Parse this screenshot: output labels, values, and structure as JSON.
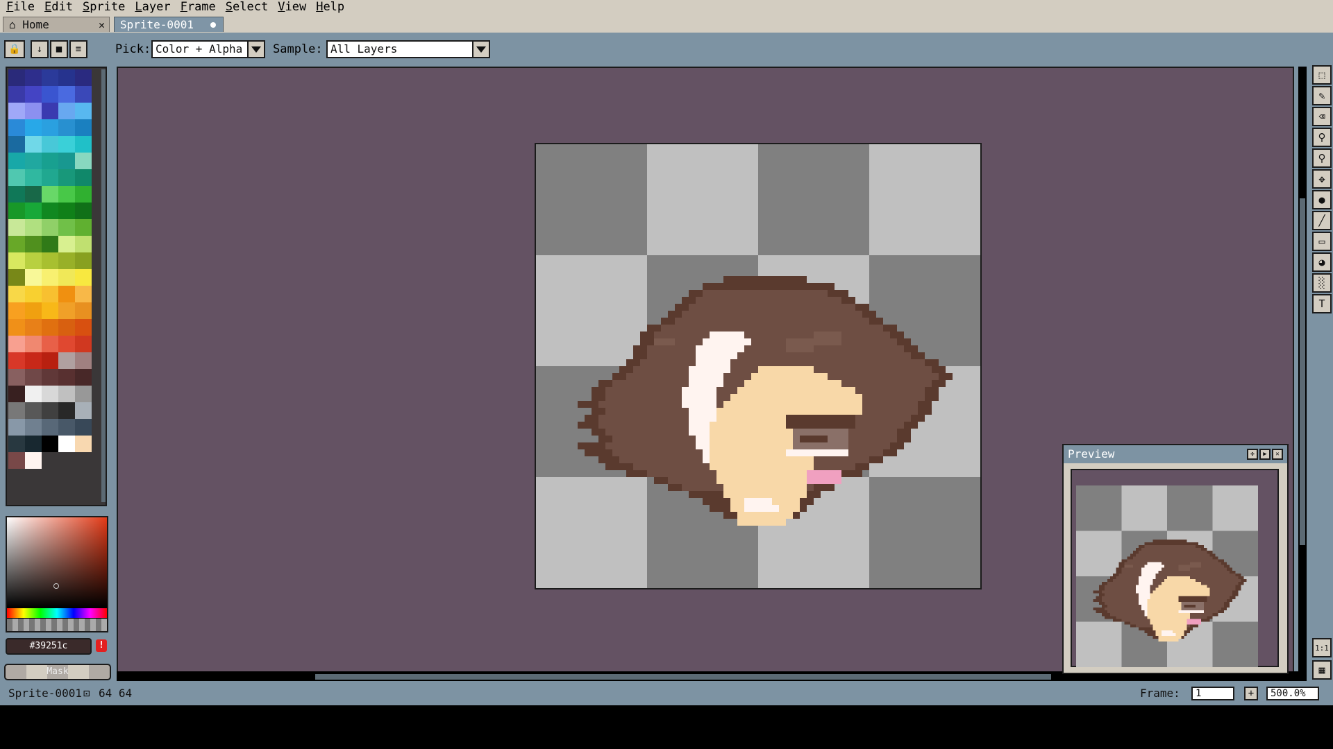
{
  "menu": [
    {
      "accel": "F",
      "rest": "ile"
    },
    {
      "accel": "E",
      "rest": "dit"
    },
    {
      "accel": "S",
      "rest": "prite"
    },
    {
      "accel": "L",
      "rest": "ayer"
    },
    {
      "accel": "F",
      "rest": "rame"
    },
    {
      "accel": "S",
      "rest": "elect"
    },
    {
      "accel": "V",
      "rest": "iew"
    },
    {
      "accel": "H",
      "rest": "elp"
    }
  ],
  "tabs": {
    "home": {
      "label": "Home",
      "close": "✕"
    },
    "sprite": {
      "label": "Sprite-0001"
    }
  },
  "context_bar": {
    "pick_label": "Pick:",
    "pick_value": "Color + Alpha",
    "sample_label": "Sample:",
    "sample_value": "All Layers"
  },
  "palette_colors": [
    "#2a2a7a",
    "#2e2e8c",
    "#2b3a9a",
    "#26338e",
    "#2a2a80",
    "#3a3aa8",
    "#4444c4",
    "#3a55d0",
    "#4a6ae0",
    "#3a48b8",
    "#a0a8f8",
    "#8c90f0",
    "#3a3ab0",
    "#68a8f0",
    "#58b8f0",
    "#2a8ad8",
    "#28a8e8",
    "#2aa0e0",
    "#2890d0",
    "#1a80c0",
    "#1a6aa0",
    "#70d8e8",
    "#48c8d8",
    "#3ad0d8",
    "#20c0c8",
    "#18a8a8",
    "#20a8a0",
    "#18a090",
    "#189890",
    "#88d8c0",
    "#50c8b0",
    "#30b8a0",
    "#20a890",
    "#18987a",
    "#10886a",
    "#107858",
    "#186848",
    "#68d868",
    "#48c848",
    "#30b030",
    "#189828",
    "#18a838",
    "#108820",
    "#108018",
    "#107018",
    "#c8e898",
    "#b0e080",
    "#90d068",
    "#70c048",
    "#60b030",
    "#68a828",
    "#50901e",
    "#307a18",
    "#d8f090",
    "#c0e070",
    "#d8e860",
    "#b8d040",
    "#a8c030",
    "#98b028",
    "#88a020",
    "#788818",
    "#f8f898",
    "#f8f070",
    "#f0e858",
    "#f8e840",
    "#f8d848",
    "#f8d030",
    "#f8c030",
    "#f09010",
    "#f8b848",
    "#f8a020",
    "#f0a010",
    "#f8b818",
    "#f0a028",
    "#e89020",
    "#f09018",
    "#e88018",
    "#e07010",
    "#d86010",
    "#d85010",
    "#f8a090",
    "#f08870",
    "#e86048",
    "#e04830",
    "#d03820",
    "#d83828",
    "#c82818",
    "#b82010",
    "#b0a0a0",
    "#a08080",
    "#886060",
    "#704848",
    "#603838",
    "#583030",
    "#482828",
    "#382020",
    "#f0f0f0",
    "#d8d8d8",
    "#c0c0c0",
    "#989898",
    "#787878",
    "#585858",
    "#404040",
    "#282828",
    "#a8b0b8",
    "#8898a8",
    "#708090",
    "#586878",
    "#485868",
    "#384858",
    "#283840",
    "#182830",
    "#000000",
    "#ffffff",
    "#f8d8b0",
    "#784848",
    "#fff4f0"
  ],
  "picker": {
    "hex": "#39251c",
    "warn": "!",
    "mask_label": "Mask"
  },
  "tools": [
    "marquee-icon",
    "pencil-icon",
    "eraser-icon",
    "eyedropper-icon",
    "zoom-icon",
    "move-icon",
    "fill-icon",
    "line-icon",
    "rectangle-icon",
    "blur-icon",
    "spray-icon",
    "text-icon"
  ],
  "preview": {
    "title": "Preview"
  },
  "sprite_colors": {
    "dark": "#5a3a2e",
    "hair": "#6e4e43",
    "hair_shadow": "#7a5a4e",
    "skin": "#f8d8a8",
    "white": "#fff4f0",
    "eye": "#8a7068",
    "blush": "#f0a0c0",
    "checker_dark": "#808080",
    "checker_light": "#c0c0c0"
  },
  "status": {
    "sprite_name": "Sprite-0001",
    "size": "64 64",
    "frame_label": "Frame:",
    "frame_value": "1",
    "zoom_value": "500.0%"
  }
}
